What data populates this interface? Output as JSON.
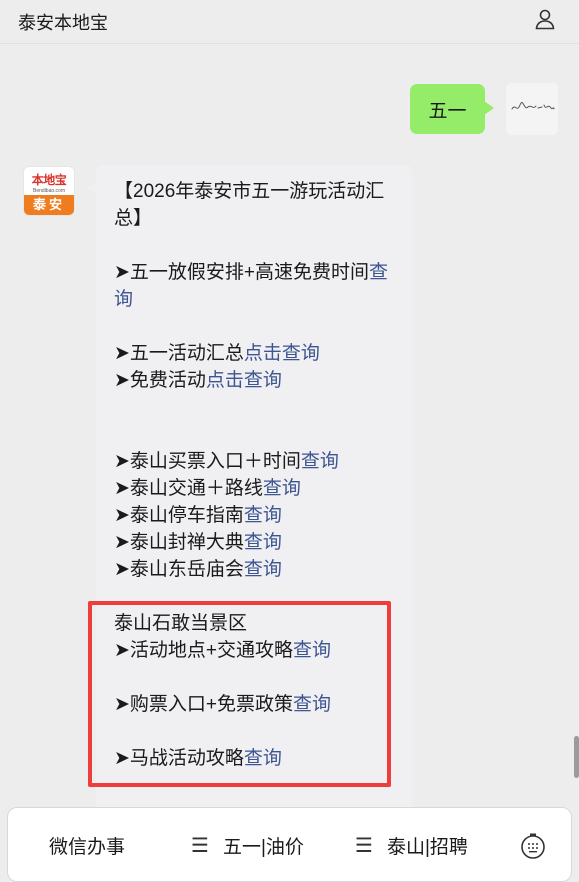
{
  "header": {
    "title": "泰安本地宝"
  },
  "outgoing": {
    "text": "五一"
  },
  "bot": {
    "logo_top": "本地宝",
    "logo_mid": "Bendibao.com",
    "logo_bottom": "泰安"
  },
  "message": {
    "title": "【2026年泰安市五一游玩活动汇总】",
    "section1": {
      "text": "➤五一放假安排+高速免费时间",
      "link": "查询"
    },
    "section2": [
      {
        "text": "➤五一活动汇总",
        "link": "点击查询"
      },
      {
        "text": "➤免费活动",
        "link": "点击查询"
      }
    ],
    "section3": [
      {
        "text": "➤泰山买票入口＋时间",
        "link": "查询"
      },
      {
        "text": "➤泰山交通＋路线",
        "link": "查询"
      },
      {
        "text": "➤泰山停车指南",
        "link": "查询"
      },
      {
        "text": "➤泰山封禅大典",
        "link": "查询"
      },
      {
        "text": "➤泰山东岳庙会",
        "link": "查询"
      }
    ],
    "section4": {
      "heading": "泰山石敢当景区",
      "items": [
        {
          "text": "➤活动地点+交通攻略",
          "link": "查询"
        },
        {
          "text": "➤购票入口+免票政策",
          "link": "查询"
        },
        {
          "text": "➤马战活动攻略",
          "link": "查询"
        }
      ]
    }
  },
  "menu": {
    "item1": "微信办事",
    "item2": "五一|油价",
    "item3": "泰山|招聘"
  },
  "colors": {
    "bubble_out": "#95ec69",
    "link": "#3d5591",
    "highlight": "#ee3d3d",
    "logo_orange": "#ef7c1f"
  }
}
